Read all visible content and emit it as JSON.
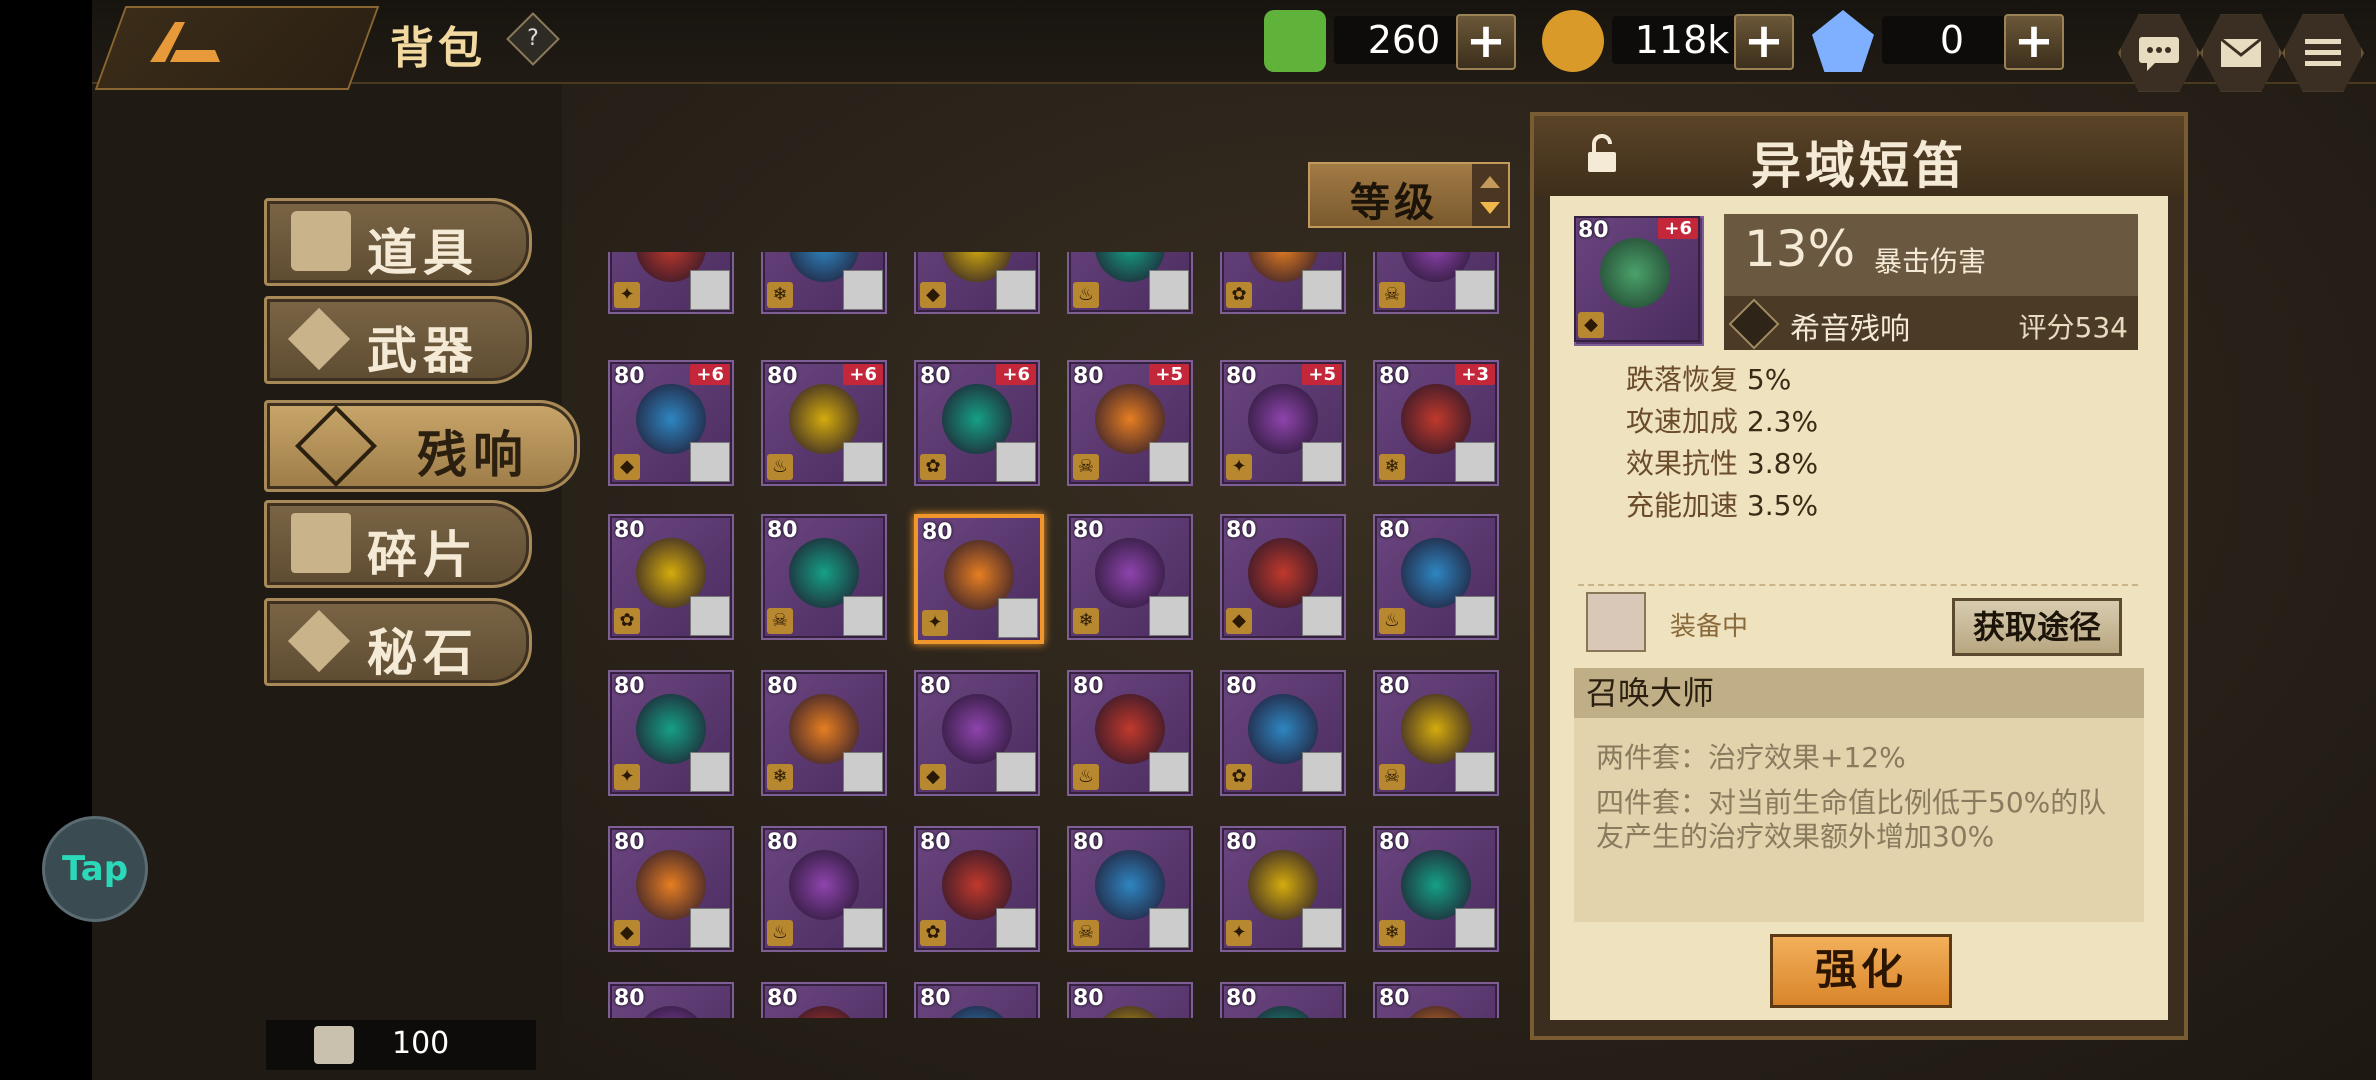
{
  "header": {
    "title": "背包",
    "help": "?"
  },
  "resources": [
    {
      "name": "stamina",
      "value": "260",
      "color": "#5fb23a"
    },
    {
      "name": "gold",
      "value": "118k",
      "color": "#d99a2a"
    },
    {
      "name": "crystal",
      "value": "0",
      "color": "#7fb0ff"
    }
  ],
  "tabs": [
    {
      "label": "道具"
    },
    {
      "label": "武器"
    },
    {
      "label": "残响"
    },
    {
      "label": "碎片"
    },
    {
      "label": "秘石"
    }
  ],
  "sort": {
    "label": "等级"
  },
  "capacity": "100",
  "tap_label": "Tap",
  "grid": {
    "rows": [
      [
        {
          "lv": "",
          "plus": ""
        },
        {
          "lv": "",
          "plus": ""
        },
        {
          "lv": "",
          "plus": ""
        },
        {
          "lv": "",
          "plus": ""
        },
        {
          "lv": "",
          "plus": ""
        },
        {
          "lv": "",
          "plus": ""
        }
      ],
      [
        {
          "lv": "80",
          "plus": "+6"
        },
        {
          "lv": "80",
          "plus": "+6"
        },
        {
          "lv": "80",
          "plus": "+6"
        },
        {
          "lv": "80",
          "plus": "+5"
        },
        {
          "lv": "80",
          "plus": "+5"
        },
        {
          "lv": "80",
          "plus": "+3"
        }
      ],
      [
        {
          "lv": "80",
          "plus": ""
        },
        {
          "lv": "80",
          "plus": ""
        },
        {
          "lv": "80",
          "plus": ""
        },
        {
          "lv": "80",
          "plus": ""
        },
        {
          "lv": "80",
          "plus": ""
        },
        {
          "lv": "80",
          "plus": ""
        }
      ],
      [
        {
          "lv": "80",
          "plus": ""
        },
        {
          "lv": "80",
          "plus": ""
        },
        {
          "lv": "80",
          "plus": ""
        },
        {
          "lv": "80",
          "plus": ""
        },
        {
          "lv": "80",
          "plus": ""
        },
        {
          "lv": "80",
          "plus": ""
        }
      ],
      [
        {
          "lv": "80",
          "plus": ""
        },
        {
          "lv": "80",
          "plus": ""
        },
        {
          "lv": "80",
          "plus": ""
        },
        {
          "lv": "80",
          "plus": ""
        },
        {
          "lv": "80",
          "plus": ""
        },
        {
          "lv": "80",
          "plus": ""
        }
      ],
      [
        {
          "lv": "80",
          "plus": ""
        },
        {
          "lv": "80",
          "plus": ""
        },
        {
          "lv": "80",
          "plus": ""
        },
        {
          "lv": "80",
          "plus": ""
        },
        {
          "lv": "80",
          "plus": ""
        },
        {
          "lv": "80",
          "plus": ""
        }
      ]
    ]
  },
  "detail": {
    "name": "异域短笛",
    "level": "80",
    "plus": "+6",
    "main_stat_value": "13%",
    "main_stat_name": "暴击伤害",
    "set_name": "希音残响",
    "score": "评分534",
    "substats": [
      {
        "k": "跌落恢复",
        "v": "5%"
      },
      {
        "k": "攻速加成",
        "v": "2.3%"
      },
      {
        "k": "效果抗性",
        "v": "3.8%"
      },
      {
        "k": "充能加速",
        "v": "3.5%"
      }
    ],
    "equipped_label": "装备中",
    "obtain_label": "获取途径",
    "set_title": "召唤大师",
    "set_2": "两件套：治疗效果+12%",
    "set_4": "四件套：对当前生命值比例低于50%的队友产生的治疗效果额外增加30%",
    "enhance_label": "强化"
  }
}
